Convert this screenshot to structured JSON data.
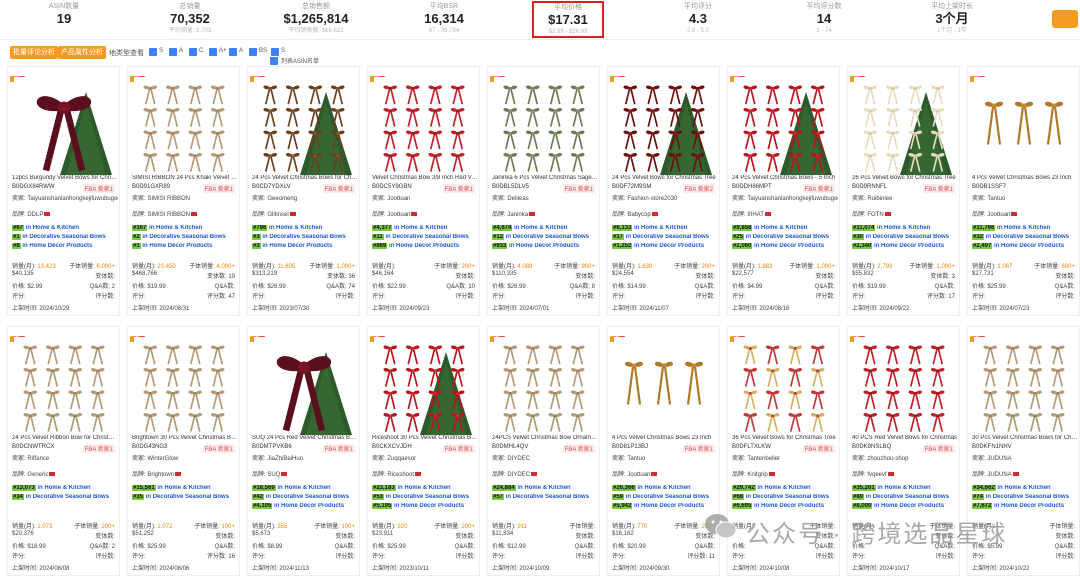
{
  "stats": [
    {
      "label": "ASIN数量",
      "value": "19",
      "sub": ""
    },
    {
      "label": "总销量",
      "value": "70,352",
      "sub": "平均销量: 3,703"
    },
    {
      "label": "总销售额",
      "value": "$1,265,814",
      "sub": "平均销售额: $66,622"
    },
    {
      "label": "平均BSR",
      "value": "16,314",
      "sub": "67 - 39,794"
    },
    {
      "label": "平均价格",
      "value": "$17.31",
      "sub": "$2.99 - $26.99"
    },
    {
      "label": "平均评分",
      "value": "4.3",
      "sub": "2.8 - 5.0"
    },
    {
      "label": "平均评分数",
      "value": "14",
      "sub": "1 - 74"
    },
    {
      "label": "平均上架时长",
      "value": "3个月",
      "sub": "1个月 - 1年"
    }
  ],
  "toolbar": {
    "btn1": "批量评论分析",
    "btn2": "产品属性分析",
    "type_label": "地类型查看",
    "checks": [
      "S",
      "A",
      "C",
      "A+",
      "A",
      "BS",
      "S"
    ],
    "asin_toggle": "列表ASIN名单"
  },
  "labels": {
    "seller": "卖家:",
    "brand": "品牌:",
    "sales": "销量(月):",
    "variants": "变体数:",
    "price": "价格:",
    "sub_sales": "子体销量:",
    "qa": "Q&A数:",
    "rating": "评分:",
    "reviews": "评分数:",
    "listed": "上架时间:",
    "in": "in"
  },
  "colors": {
    "accent": "#f59a23",
    "rank_bg": "#7ac943",
    "link": "#1a56db",
    "highlight": "#e02020"
  },
  "products": [
    {
      "title": "12pcs Burgundy Velvet Bows for Christmas",
      "asin": "B0DGX84RWW",
      "fba": "FBA 卖家1",
      "seller": "Taiyuanshanlanhongkejifuwubugerenduzi",
      "brand": "DDLP",
      "ranks": [
        [
          "#67",
          "Home & Kitchen"
        ],
        [
          "#1",
          "Decorative Seasonal Bows"
        ],
        [
          "#8",
          "Home Décor Products"
        ]
      ],
      "sales": "13,423",
      "sub_sales": "6,000+",
      "variants": "",
      "price": "$40,135",
      "qa": "2",
      "rating": "$2.99",
      "reviews": "",
      "listed": "2024/10/29",
      "img": "burgundy"
    },
    {
      "title": "SIMISI RIBBON 24 Pcs Khaki Velvet Bows",
      "asin": "B0D91GXR89",
      "fba": "FBA 卖家1",
      "seller": "SIMISI RIBBON",
      "brand": "SIMISI RIBBON",
      "ranks": [
        [
          "#167",
          "Home & Kitchen"
        ],
        [
          "#2",
          "Decorative Seasonal Bows"
        ],
        [
          "#1",
          "Home Décor Products"
        ]
      ],
      "sales": "23,450",
      "sub_sales": "4,000+",
      "variants": "19",
      "price": "$468,766",
      "qa": "",
      "rating": "$19.99",
      "reviews": "47",
      "listed": "2024/08/31",
      "img": "khaki"
    },
    {
      "title": "24 Pcs Velvet Christmas Bows for Christmas",
      "asin": "B0CD7YDXLV",
      "fba": "FBA 卖家1",
      "seller": "Geeomeng",
      "brand": "Glitinsel",
      "ranks": [
        [
          "#786",
          "Home & Kitchen"
        ],
        [
          "#3",
          "Decorative Seasonal Bows"
        ],
        [
          "#3",
          "Home Décor Products"
        ]
      ],
      "sales": "11,605",
      "sub_sales": "1,000+",
      "variants": "36",
      "price": "$313,219",
      "qa": "74",
      "rating": "$26.99",
      "reviews": "",
      "listed": "2023/07/30",
      "img": "brown"
    },
    {
      "title": "Velvet Christmas Bow 3/8 Inch Red Velvet",
      "asin": "B0DC5Y9GBN",
      "fba": "FBA 卖家1",
      "seller": "Joottuan",
      "brand": "Joottuan",
      "ranks": [
        [
          "#4,377",
          "Home & Kitchen"
        ],
        [
          "#11",
          "Decorative Seasonal Bows"
        ],
        [
          "#869",
          "Home Décor Products"
        ]
      ],
      "sales": "",
      "sub_sales": "200+",
      "variants": "",
      "price": "$46,164",
      "qa": "10",
      "rating": "$22.99",
      "reviews": "",
      "listed": "2024/09/23",
      "img": "redsmall"
    },
    {
      "title": "Janinka 6 Pcs Velvet Christmas Sage Bows",
      "asin": "B0DBL5DLV5",
      "fba": "FBA 卖家1",
      "seller": "Delileas",
      "brand": "Janinka",
      "ranks": [
        [
          "#4,674",
          "Home & Kitchen"
        ],
        [
          "#12",
          "Decorative Seasonal Bows"
        ],
        [
          "#933",
          "Home Décor Products"
        ]
      ],
      "sales": "4,088",
      "sub_sales": "900+",
      "variants": "",
      "price": "$110,335",
      "qa": "8",
      "rating": "$26.99",
      "reviews": "",
      "listed": "2024/07/01",
      "img": "sage"
    },
    {
      "title": "24 Pcs Velvet Bows for Christmas Tree",
      "asin": "B0DF72M9SM",
      "fba": "FBA 卖家2",
      "seller": "Fashion-store2030",
      "brand": "Babycop",
      "ranks": [
        [
          "#6,133",
          "Home & Kitchen"
        ],
        [
          "#17",
          "Decorative Seasonal Bows"
        ],
        [
          "#1,252",
          "Home Décor Products"
        ]
      ],
      "sales": "1,638",
      "sub_sales": "200+",
      "variants": "",
      "price": "$24,554",
      "qa": "",
      "rating": "$14.99",
      "reviews": "",
      "listed": "2024/11/07",
      "img": "darkred"
    },
    {
      "title": "24 Pcs Velvet Christmas Bows - 5 Inch",
      "asin": "B0DDH86MPT",
      "fba": "FBA 卖家1",
      "seller": "Taiyuanshanlanhongkejifuwubugerenduzi",
      "brand": "IIIHAT",
      "ranks": [
        [
          "#9,858",
          "Home & Kitchen"
        ],
        [
          "#25",
          "Decorative Seasonal Bows"
        ],
        [
          "#2,060",
          "Home Décor Products"
        ]
      ],
      "sales": "1,883",
      "sub_sales": "1,000+",
      "variants": "",
      "price": "$22,577",
      "qa": "",
      "rating": "$4.99",
      "reviews": "",
      "listed": "2024/08/16",
      "img": "red"
    },
    {
      "title": "26 Pcs Velvet Bows for Christmas Tree",
      "asin": "B0D9RNNFL",
      "fba": "FBA 卖家1",
      "seller": "Ruibinlee",
      "brand": "FOTN",
      "ranks": [
        [
          "#11,074",
          "Home & Kitchen"
        ],
        [
          "#30",
          "Decorative Seasonal Bows"
        ],
        [
          "#2,340",
          "Home Décor Products"
        ]
      ],
      "sales": "2,793",
      "sub_sales": "1,000+",
      "variants": "3",
      "price": "$55,832",
      "qa": "",
      "rating": "$19.99",
      "reviews": "17",
      "listed": "2024/09/22",
      "img": "cream"
    },
    {
      "title": "4 Pcs Velvet Christmas Bows 23 Inch",
      "asin": "B0DB1SSF7",
      "fba": "",
      "seller": "Tantuo",
      "brand": "Joottuan",
      "ranks": [
        [
          "#11,766",
          "Home & Kitchen"
        ],
        [
          "#32",
          "Decorative Seasonal Bows"
        ],
        [
          "#2,497",
          "Home Décor Products"
        ]
      ],
      "sales": "1,067",
      "sub_sales": "600+",
      "variants": "",
      "price": "$27,731",
      "qa": "",
      "rating": "$25.99",
      "reviews": "",
      "listed": "2024/07/23",
      "img": "gold"
    },
    {
      "title": "24 Pcs Velvet Ribbon Bow for Christmas",
      "asin": "B0DCNWTRCX",
      "fba": "FBA 卖家1",
      "seller": "Riffance",
      "brand": "Generic",
      "ranks": [
        [
          "#13,073",
          "Home & Kitchen"
        ],
        [
          "#34",
          "Decorative Seasonal Bows"
        ],
        [
          "",
          ""
        ]
      ],
      "sales": "1,073",
      "sub_sales": "200+",
      "variants": "",
      "price": "$20,376",
      "qa": "2",
      "rating": "$18.99",
      "reviews": "",
      "listed": "2024/08/08",
      "img": "khaki"
    },
    {
      "title": "Brightown 30 Pcs Velvet Christmas Bows",
      "asin": "B0DG43NG3",
      "fba": "FBA 卖家1",
      "seller": "WinterGlow",
      "brand": "Brightown",
      "ranks": [
        [
          "#15,561",
          "Home & Kitchen"
        ],
        [
          "#35",
          "Decorative Seasonal Bows"
        ],
        [
          "",
          ""
        ]
      ],
      "sales": "1,072",
      "sub_sales": "100+",
      "variants": "",
      "price": "$51,252",
      "qa": "",
      "rating": "$25.99",
      "reviews": "16",
      "listed": "2024/08/06",
      "img": "khaki"
    },
    {
      "title": "SUQ 24 Pcs Red Velvet Christmas Bows",
      "asin": "B0DMTPVKB6",
      "fba": "FBA 卖家1",
      "seller": "JiaZhiBaiHuo",
      "brand": "SUQ",
      "ranks": [
        [
          "#18,569",
          "Home & Kitchen"
        ],
        [
          "#42",
          "Decorative Seasonal Bows"
        ],
        [
          "#4,105",
          "Home Décor Products"
        ]
      ],
      "sales": "355",
      "sub_sales": "100+",
      "variants": "",
      "price": "$5,673",
      "qa": "",
      "rating": "$8.99",
      "reviews": "",
      "listed": "2024/11/13",
      "img": "burgundy"
    },
    {
      "title": "Riceshoot 30 Pcs Velvet Christmas Bows",
      "asin": "B0CKXCVJDH",
      "fba": "FBA 卖家1",
      "seller": "Zuqqaesor",
      "brand": "Riceshoot",
      "ranks": [
        [
          "#23,183",
          "Home & Kitchen"
        ],
        [
          "#53",
          "Decorative Seasonal Bows"
        ],
        [
          "#5,195",
          "Home Décor Products"
        ]
      ],
      "sales": "920",
      "sub_sales": "200+",
      "variants": "",
      "price": "$23,911",
      "qa": "",
      "rating": "$25.99",
      "reviews": "",
      "listed": "2023/10/11",
      "img": "red"
    },
    {
      "title": "24PCS Velvet Christmas Bow Ornaments",
      "asin": "B0DMHL4QV",
      "fba": "FBA 卖家1",
      "seller": "DIYDEC",
      "brand": "DIYDEC",
      "ranks": [
        [
          "#24,884",
          "Home & Kitchen"
        ],
        [
          "#57",
          "Decorative Seasonal Bows"
        ],
        [
          "",
          ""
        ]
      ],
      "sales": "911",
      "sub_sales": "",
      "variants": "",
      "price": "$11,834",
      "qa": "",
      "rating": "$12.99",
      "reviews": "",
      "listed": "2024/10/09",
      "img": "khaki"
    },
    {
      "title": "4 Pcs Velvet Christmas Bows 23 Inch",
      "asin": "B0D81P13BJ",
      "fba": "FBA 卖家1",
      "seller": "Tantuo",
      "brand": "Joottuan",
      "ranks": [
        [
          "#26,366",
          "Home & Kitchen"
        ],
        [
          "#59",
          "Decorative Seasonal Bows"
        ],
        [
          "#5,942",
          "Home Décor Products"
        ]
      ],
      "sales": "770",
      "sub_sales": "200+",
      "variants": "",
      "price": "$16,162",
      "qa": "",
      "rating": "$20.99",
      "reviews": "11",
      "listed": "2024/09/30",
      "img": "gold"
    },
    {
      "title": "36 Pcs Velvet Bows for Christmas Tree",
      "asin": "B0DFLTXLKW",
      "fba": "FBA 卖家1",
      "seller": "Tantenbeller",
      "brand": "Knitgrip",
      "ranks": [
        [
          "#29,742",
          "Home & Kitchen"
        ],
        [
          "#68",
          "Decorative Seasonal Bows"
        ],
        [
          "#6,695",
          "Home Décor Products"
        ]
      ],
      "sales": "",
      "sub_sales": "",
      "variants": "",
      "price": "",
      "qa": "",
      "rating": "",
      "reviews": "",
      "listed": "2024/10/08",
      "img": "multi"
    },
    {
      "title": "40 PCS Red Velvet Bows for Christmas",
      "asin": "B0DK8NSLBQ",
      "fba": "FBA 卖家1",
      "seller": "zhouzhou-shop",
      "brand": "fvqeevf",
      "ranks": [
        [
          "#35,201",
          "Home & Kitchen"
        ],
        [
          "#80",
          "Decorative Seasonal Bows"
        ],
        [
          "#8,000",
          "Home Décor Products"
        ]
      ],
      "sales": "",
      "sub_sales": "",
      "variants": "",
      "price": "",
      "qa": "",
      "rating": "",
      "reviews": "",
      "listed": "2024/10/17",
      "img": "redsmall"
    },
    {
      "title": "30 Pcs Velvet Christmas Bows for Christmas",
      "asin": "B0DKFN1NHV",
      "fba": "",
      "seller": "JUDUNA",
      "brand": "JUDUNA",
      "ranks": [
        [
          "#34,662",
          "Home & Kitchen"
        ],
        [
          "#74",
          "Decorative Seasonal Bows"
        ],
        [
          "#7,672",
          "Home Décor Products"
        ]
      ],
      "sales": "",
      "sub_sales": "",
      "variants": "",
      "price": "",
      "qa": "",
      "rating": "$5.99",
      "reviews": "",
      "listed": "2024/10/22",
      "img": "khaki"
    }
  ],
  "watermark": "公众号 · 跨境选品星球"
}
